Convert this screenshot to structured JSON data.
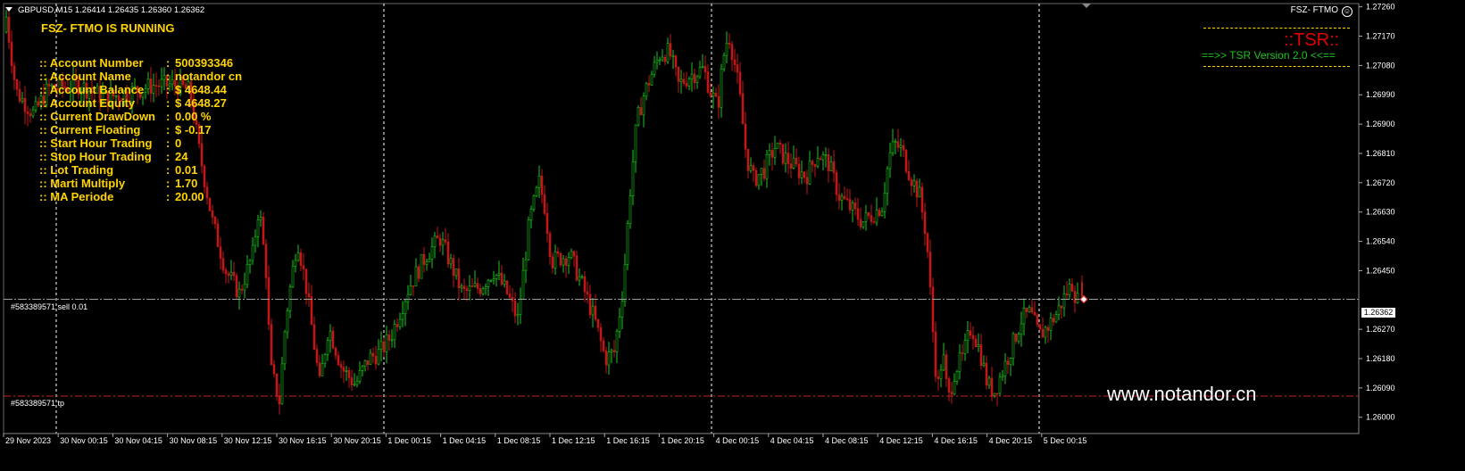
{
  "header": {
    "symbol_info": "GBPUSD,M15  1.26414 1.26435 1.26360 1.26362",
    "ea_name": "FSZ- FTMO",
    "smiley": "☺"
  },
  "panel": {
    "status": "FSZ- FTMO IS RUNNING",
    "rows": [
      {
        "label": ":: Account Number",
        "sep": ":",
        "value": "500393346"
      },
      {
        "label": ":: Account Name",
        "sep": ":",
        "value": "notandor cn"
      },
      {
        "label": ":: Account Balance",
        "sep": ":",
        "value": "$ 4648.44"
      },
      {
        "label": ":: Account Equity",
        "sep": ":",
        "value": "$ 4648.27"
      },
      {
        "label": ":: Current DrawDown",
        "sep": ":",
        "value": "0.00 %"
      },
      {
        "label": ":: Current Floating",
        "sep": ":",
        "value": "$ -0.17"
      },
      {
        "label": ":: Start Hour Trading",
        "sep": ":",
        "value": "0"
      },
      {
        "label": ":: Stop Hour Trading",
        "sep": ":",
        "value": "24"
      },
      {
        "label": ":: Lot Trading",
        "sep": ":",
        "value": "0.01"
      },
      {
        "label": ":: Marti Multiply",
        "sep": ":",
        "value": "1.70"
      },
      {
        "label": ":: MA Periode",
        "sep": ":",
        "value": "20.00"
      }
    ]
  },
  "tsr": {
    "title": "::TSR::",
    "version": "==>>  TSR Version 2.0  <<=="
  },
  "watermark": "www.notandor.cn",
  "colors": {
    "background": "#000000",
    "bull": "#1fc21f",
    "bear": "#c01818",
    "grid": "#ffffff",
    "text": "#ffffff",
    "panel_text": "#ffd400",
    "tp_line": "#cc2222"
  },
  "chart_data": {
    "type": "candlestick",
    "symbol": "GBPUSD",
    "timeframe": "M15",
    "ylim": [
      1.2595,
      1.2727
    ],
    "y_ticks": [
      "1.27260",
      "1.27170",
      "1.27080",
      "1.26990",
      "1.26900",
      "1.26810",
      "1.26720",
      "1.26630",
      "1.26540",
      "1.26450",
      "1.26362",
      "1.26270",
      "1.26180",
      "1.26090",
      "1.26000"
    ],
    "x_ticks": [
      "29 Nov 2023",
      "30 Nov 00:15",
      "30 Nov 04:15",
      "30 Nov 08:15",
      "30 Nov 12:15",
      "30 Nov 16:15",
      "30 Nov 20:15",
      "1 Dec 00:15",
      "1 Dec 04:15",
      "1 Dec 08:15",
      "1 Dec 12:15",
      "1 Dec 16:15",
      "1 Dec 20:15",
      "4 Dec 00:15",
      "4 Dec 04:15",
      "4 Dec 08:15",
      "4 Dec 12:15",
      "4 Dec 16:15",
      "4 Dec 20:15",
      "5 Dec 00:15"
    ],
    "last": {
      "open": 1.26414,
      "high": 1.26435,
      "low": 1.2636,
      "close": 1.26362
    },
    "current_price": "1.26362",
    "orders": [
      {
        "label": "#583389571 sell 0.01",
        "price": 1.26362
      },
      {
        "label": "#583389571 tp",
        "price": 1.26065
      }
    ],
    "path_points": [
      [
        0,
        1.2698
      ],
      [
        8,
        1.2725
      ],
      [
        20,
        1.27
      ],
      [
        40,
        1.2693
      ],
      [
        56,
        1.2701
      ],
      [
        90,
        1.2702
      ],
      [
        120,
        1.2698
      ],
      [
        150,
        1.27
      ],
      [
        175,
        1.2702
      ],
      [
        200,
        1.2702
      ],
      [
        215,
        1.27
      ],
      [
        225,
        1.2682
      ],
      [
        240,
        1.266
      ],
      [
        255,
        1.2645
      ],
      [
        270,
        1.2638
      ],
      [
        285,
        1.265
      ],
      [
        292,
        1.2665
      ],
      [
        300,
        1.2645
      ],
      [
        305,
        1.2615
      ],
      [
        315,
        1.2605
      ],
      [
        322,
        1.263
      ],
      [
        335,
        1.2655
      ],
      [
        345,
        1.264
      ],
      [
        360,
        1.261
      ],
      [
        370,
        1.2628
      ],
      [
        385,
        1.2615
      ],
      [
        400,
        1.261
      ],
      [
        415,
        1.2618
      ],
      [
        428,
        1.262
      ],
      [
        440,
        1.2625
      ],
      [
        460,
        1.264
      ],
      [
        480,
        1.265
      ],
      [
        495,
        1.2655
      ],
      [
        510,
        1.2645
      ],
      [
        520,
        1.2638
      ],
      [
        540,
        1.264
      ],
      [
        555,
        1.2645
      ],
      [
        570,
        1.2638
      ],
      [
        582,
        1.263
      ],
      [
        595,
        1.266
      ],
      [
        606,
        1.2672
      ],
      [
        612,
        1.2665
      ],
      [
        620,
        1.2648
      ],
      [
        640,
        1.265
      ],
      [
        655,
        1.264
      ],
      [
        668,
        1.263
      ],
      [
        680,
        1.2618
      ],
      [
        690,
        1.262
      ],
      [
        700,
        1.264
      ],
      [
        708,
        1.267
      ],
      [
        715,
        1.269
      ],
      [
        722,
        1.2698
      ],
      [
        730,
        1.2704
      ],
      [
        742,
        1.2712
      ],
      [
        752,
        1.2712
      ],
      [
        762,
        1.2702
      ],
      [
        775,
        1.2705
      ],
      [
        790,
        1.2707
      ],
      [
        798,
        1.27
      ],
      [
        806,
        1.2695
      ],
      [
        812,
        1.271
      ],
      [
        818,
        1.2718
      ],
      [
        824,
        1.271
      ],
      [
        830,
        1.27
      ],
      [
        838,
        1.268
      ],
      [
        846,
        1.2673
      ],
      [
        858,
        1.2676
      ],
      [
        870,
        1.2683
      ],
      [
        880,
        1.268
      ],
      [
        895,
        1.2676
      ],
      [
        905,
        1.2674
      ],
      [
        918,
        1.2681
      ],
      [
        930,
        1.2678
      ],
      [
        942,
        1.2668
      ],
      [
        955,
        1.2664
      ],
      [
        968,
        1.266
      ],
      [
        978,
        1.2662
      ],
      [
        990,
        1.2665
      ],
      [
        998,
        1.268
      ],
      [
        1004,
        1.2684
      ],
      [
        1012,
        1.2682
      ],
      [
        1022,
        1.2674
      ],
      [
        1032,
        1.2668
      ],
      [
        1040,
        1.2655
      ],
      [
        1046,
        1.263
      ],
      [
        1052,
        1.2608
      ],
      [
        1058,
        1.262
      ],
      [
        1064,
        1.2605
      ],
      [
        1072,
        1.2615
      ],
      [
        1080,
        1.2618
      ],
      [
        1090,
        1.2628
      ],
      [
        1100,
        1.262
      ],
      [
        1108,
        1.261
      ],
      [
        1116,
        1.2608
      ],
      [
        1126,
        1.2615
      ],
      [
        1136,
        1.2622
      ],
      [
        1146,
        1.263
      ],
      [
        1156,
        1.2632
      ],
      [
        1166,
        1.2625
      ],
      [
        1176,
        1.2628
      ],
      [
        1186,
        1.2632
      ],
      [
        1196,
        1.2638
      ],
      [
        1203,
        1.2641
      ],
      [
        1208,
        1.2636
      ]
    ]
  }
}
